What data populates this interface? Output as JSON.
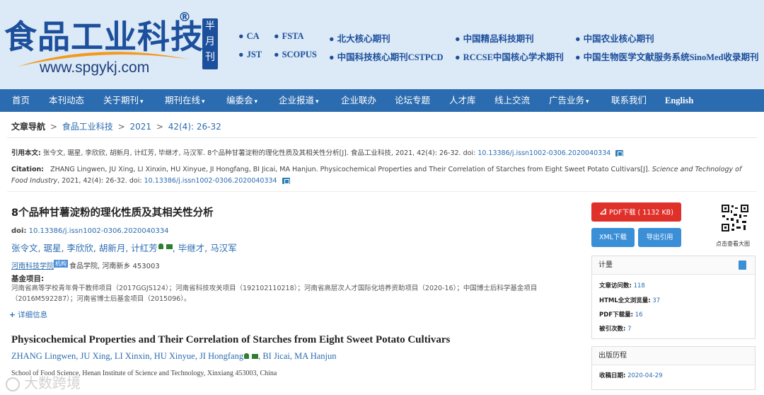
{
  "header": {
    "logo_title": "食品工业科技",
    "logo_reg": "®",
    "logo_url": "www.spgykj.com",
    "half_month": "半月刊",
    "tags": [
      "CA",
      "FSTA",
      "北大核心期刊",
      "中国精品科技期刊",
      "中国农业核心期刊",
      "JST",
      "SCOPUS",
      "中国科技核心期刊CSTPCD",
      "RCCSE中国核心学术期刊",
      "中国生物医学文献服务系统SinoMed收录期刊"
    ]
  },
  "nav": {
    "items": [
      "首页",
      "本刊动态",
      "关于期刊",
      "期刊在线",
      "编委会",
      "企业报道",
      "企业联办",
      "论坛专题",
      "人才库",
      "线上交流",
      "广告业务",
      "联系我们",
      "English"
    ],
    "dropdown_arrow": "▾"
  },
  "breadcrumb": {
    "label": "文章导航",
    "items": [
      "食品工业科技",
      "2021",
      "42(4): 26-32"
    ],
    "separator": ">"
  },
  "citation": {
    "zh_label": "引用本文:",
    "zh_text": "张令文, 琚星, 李欣欣, 胡新月, 计红芳, 毕继才, 马汉军. 8个品种甘薯淀粉的理化性质及其相关性分析[J]. 食品工业科技, 2021, 42(4): 26-32. doi:",
    "zh_doi": "10.13386/j.issn1002-0306.2020040334",
    "en_label": "Citation:",
    "en_text": "ZHANG Lingwen, JU Xing, LI Xinxin, HU Xinyue, JI Hongfang, BI Jicai, MA Hanjun. Physicochemical Properties and Their Correlation of Starches from Eight Sweet Potato Cultivars[J].",
    "en_journal": "Science and Technology of Food Industry",
    "en_tail": ", 2021, 42(4): 26-32. doi:",
    "en_doi": "10.13386/j.issn1002-0306.2020040334"
  },
  "article": {
    "title_zh": "8个品种甘薯淀粉的理化性质及其相关性分析",
    "doi_label": "doi:",
    "doi": "10.13386/j.issn1002-0306.2020040334",
    "authors_zh_a": "张令文, 琚星, 李欣欣, 胡新月, 计红芳",
    "authors_zh_b": ", 毕继才, 马汉军",
    "affil_link": "河南科技学院",
    "affil_badge": "机构",
    "affil_rest": "食品学院, 河南新乡 453003",
    "fund_label": "基金项目:",
    "fund_text": "河南省高等学校青年骨干教师项目（2017GGJS124）；河南省科技攻关项目（192102110218）；河南省高层次人才国际化培养资助项目（2020-16）；中国博士后科学基金项目（2016M592287）；河南省博士后基金项目（2015096）。",
    "more_plus": "+",
    "more_label": "详细信息",
    "title_en": "Physicochemical Properties and Their Correlation of Starches from Eight Sweet Potato Cultivars",
    "authors_en_a": "ZHANG Lingwen, JU Xing, LI Xinxin, HU Xinyue, JI Hongfang",
    "authors_en_b": ", BI Jicai, MA Hanjun",
    "affil_en": "School of Food Science, Henan Institute of Science and Technology, Xinxiang 453003, China"
  },
  "watermark": "大数跨境",
  "sidebar": {
    "pdf_label": "PDF下载 ( 1132 KB)",
    "xml_label": "XML下载",
    "export_label": "导出引用",
    "qr_caption": "点击查看大图",
    "metrics_title": "计量",
    "metrics": [
      {
        "label": "文章访问数:",
        "value": "118"
      },
      {
        "label": "HTML全文浏览量:",
        "value": "37"
      },
      {
        "label": "PDF下载量:",
        "value": "16"
      },
      {
        "label": "被引次数:",
        "value": "7"
      }
    ],
    "history_title": "出版历程",
    "received_label": "收稿日期:",
    "received_value": "2020-04-29"
  },
  "colors": {
    "nav_bg": "#2b6cb0",
    "header_bg": "#dce9f6",
    "brand_blue": "#1c4f9c",
    "link": "#2b6cb0",
    "pdf_button": "#e0302a",
    "secondary_button": "#3a8fd6"
  }
}
